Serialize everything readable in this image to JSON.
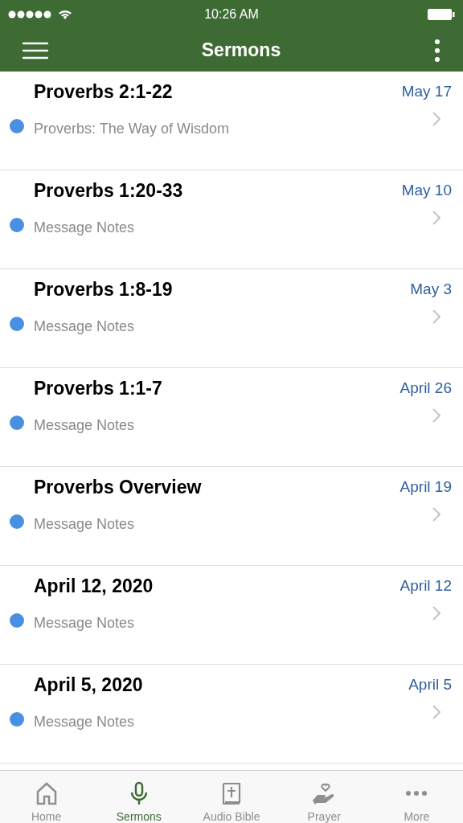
{
  "status_bar": {
    "time": "10:26 AM"
  },
  "nav_bar": {
    "title": "Sermons"
  },
  "sermons": [
    {
      "title": "Proverbs 2:1-22",
      "subtitle": "Proverbs: The Way of Wisdom",
      "date": "May 17",
      "unread": true
    },
    {
      "title": "Proverbs 1:20-33",
      "subtitle": "Message Notes",
      "date": "May 10",
      "unread": true
    },
    {
      "title": "Proverbs 1:8-19",
      "subtitle": "Message Notes",
      "date": "May 3",
      "unread": true
    },
    {
      "title": "Proverbs 1:1-7",
      "subtitle": "Message Notes",
      "date": "April 26",
      "unread": true
    },
    {
      "title": "Proverbs Overview",
      "subtitle": "Message Notes",
      "date": "April 19",
      "unread": true
    },
    {
      "title": "April 12, 2020",
      "subtitle": "Message Notes",
      "date": "April 12",
      "unread": true
    },
    {
      "title": "April 5, 2020",
      "subtitle": "Message Notes",
      "date": "April 5",
      "unread": true
    }
  ],
  "tab_bar": [
    {
      "label": "Home",
      "kind": "home",
      "selected": false
    },
    {
      "label": "Sermons",
      "kind": "mic",
      "selected": true
    },
    {
      "label": "Audio Bible",
      "kind": "bible",
      "selected": false
    },
    {
      "label": "Prayer",
      "kind": "prayer",
      "selected": false
    },
    {
      "label": "More",
      "kind": "more",
      "selected": false
    }
  ]
}
